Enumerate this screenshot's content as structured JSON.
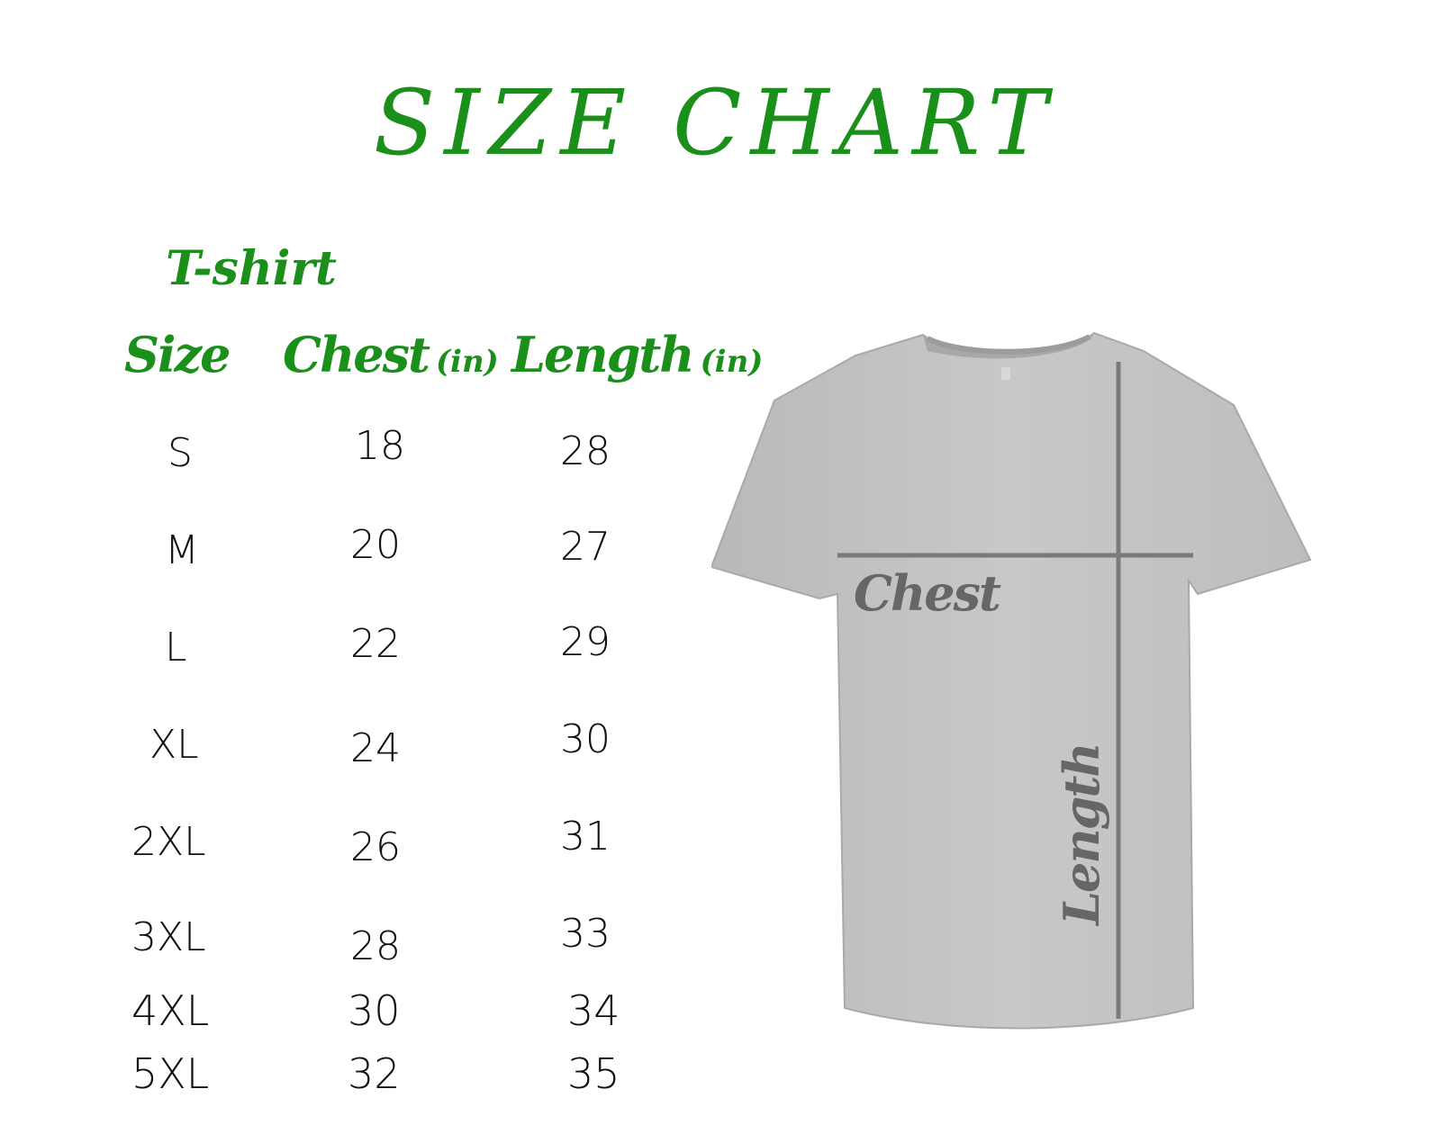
{
  "title": "SIZE CHART",
  "subtitle": "T-shirt",
  "headers": {
    "size": "Size",
    "chest": "Chest",
    "chest_unit": "(in)",
    "length": "Length",
    "length_unit": "(in)"
  },
  "rows": [
    {
      "size": "S",
      "chest": "18",
      "length": "28"
    },
    {
      "size": "M",
      "chest": "20",
      "length": "27"
    },
    {
      "size": "L",
      "chest": "22",
      "length": "29"
    },
    {
      "size": "XL",
      "chest": "24",
      "length": "30"
    },
    {
      "size": "2XL",
      "chest": "26",
      "length": "31"
    },
    {
      "size": "3XL",
      "chest": "28",
      "length": "33"
    },
    {
      "size": "4XL",
      "chest": "30",
      "length": "34"
    },
    {
      "size": "5XL",
      "chest": "32",
      "length": "35"
    }
  ],
  "diagram": {
    "chest_label": "Chest",
    "length_label": "Length"
  },
  "colors": {
    "accent": "#1a8f1a",
    "shirt": "#c4c4c6",
    "measure_line": "#7a7a7a"
  }
}
